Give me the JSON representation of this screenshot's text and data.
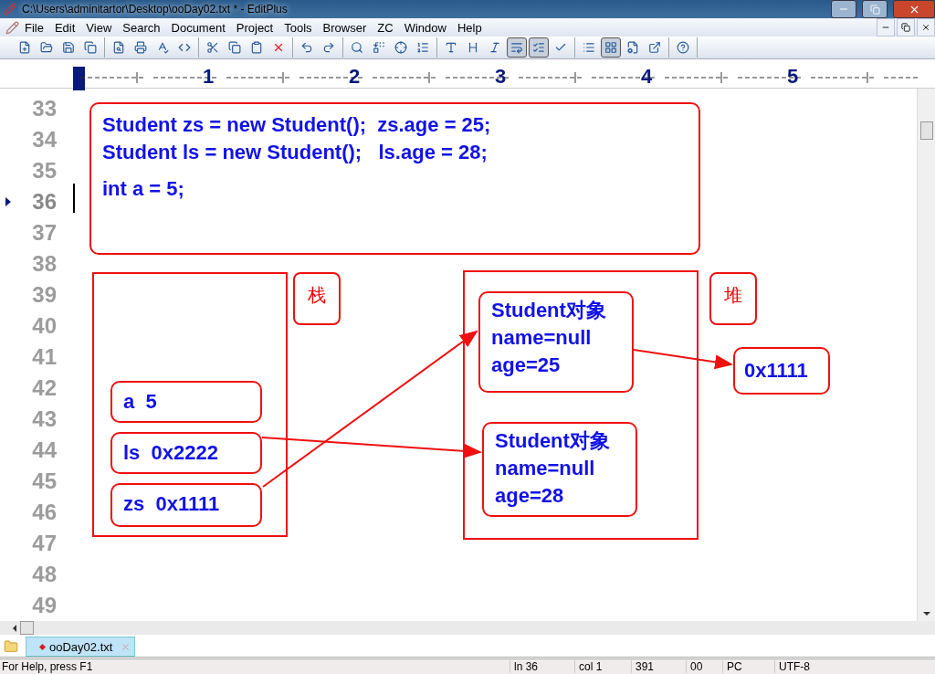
{
  "window": {
    "title": "C:\\Users\\adminitartor\\Desktop\\ooDay02.txt * - EditPlus"
  },
  "menu": [
    "File",
    "Edit",
    "View",
    "Search",
    "Document",
    "Project",
    "Tools",
    "Browser",
    "ZC",
    "Window",
    "Help"
  ],
  "toolbar": [
    [
      {
        "pressed": false
      },
      {
        "pressed": false
      },
      {
        "pressed": false
      },
      {
        "pressed": false
      }
    ],
    [
      {
        "pressed": false
      },
      {
        "pressed": false
      },
      {
        "pressed": false
      },
      {
        "pressed": false
      }
    ],
    [
      {
        "pressed": false
      },
      {
        "pressed": false
      },
      {
        "pressed": false
      },
      {
        "pressed": false
      }
    ],
    [
      {
        "pressed": false
      },
      {
        "pressed": false
      }
    ],
    [
      {
        "pressed": false
      },
      {
        "pressed": false
      },
      {
        "pressed": false
      },
      {
        "pressed": false
      }
    ],
    [
      {
        "pressed": false
      },
      {
        "pressed": false
      },
      {
        "pressed": false
      },
      {
        "pressed": true
      },
      {
        "pressed": true
      },
      {
        "pressed": false
      }
    ],
    [
      {
        "pressed": false
      },
      {
        "pressed": true
      },
      {
        "pressed": false
      },
      {
        "pressed": false
      }
    ],
    [
      {
        "pressed": false
      }
    ]
  ],
  "ruler": [
    "1",
    "2",
    "3",
    "4",
    "5"
  ],
  "editor": {
    "line_numbers": [
      {
        "number": "33",
        "current": false
      },
      {
        "number": "34",
        "current": false
      },
      {
        "number": "35",
        "current": false
      },
      {
        "number": "36",
        "current": true
      },
      {
        "number": "37",
        "current": false
      },
      {
        "number": "38",
        "current": false
      },
      {
        "number": "39",
        "current": false
      },
      {
        "number": "40",
        "current": false
      },
      {
        "number": "41",
        "current": false
      },
      {
        "number": "42",
        "current": false
      },
      {
        "number": "43",
        "current": false
      },
      {
        "number": "44",
        "current": false
      },
      {
        "number": "45",
        "current": false
      },
      {
        "number": "46",
        "current": false
      },
      {
        "number": "47",
        "current": false
      },
      {
        "number": "48",
        "current": false
      },
      {
        "number": "49",
        "current": false
      }
    ],
    "code_box": [
      "Student zs = new Student();  zs.age = 25;",
      "Student ls = new Student();   ls.age = 28;",
      "int a = 5;"
    ],
    "stack": {
      "label": "栈",
      "entries": [
        "a  5",
        "ls  0x2222",
        "zs  0x1111"
      ]
    },
    "heap": {
      "label": "堆",
      "objects": [
        [
          "Student对象",
          "name=null",
          "age=25"
        ],
        [
          "Student对象",
          "name=null",
          "age=28"
        ]
      ],
      "field_value": "0x1111"
    }
  },
  "tabs": [
    {
      "label": "ooDay02.txt",
      "selected": true
    }
  ],
  "status_bar": {
    "help": "For Help, press F1",
    "fields": [
      "ln 36",
      "col 1",
      "391",
      "00",
      "PC",
      "UTF-8"
    ]
  }
}
